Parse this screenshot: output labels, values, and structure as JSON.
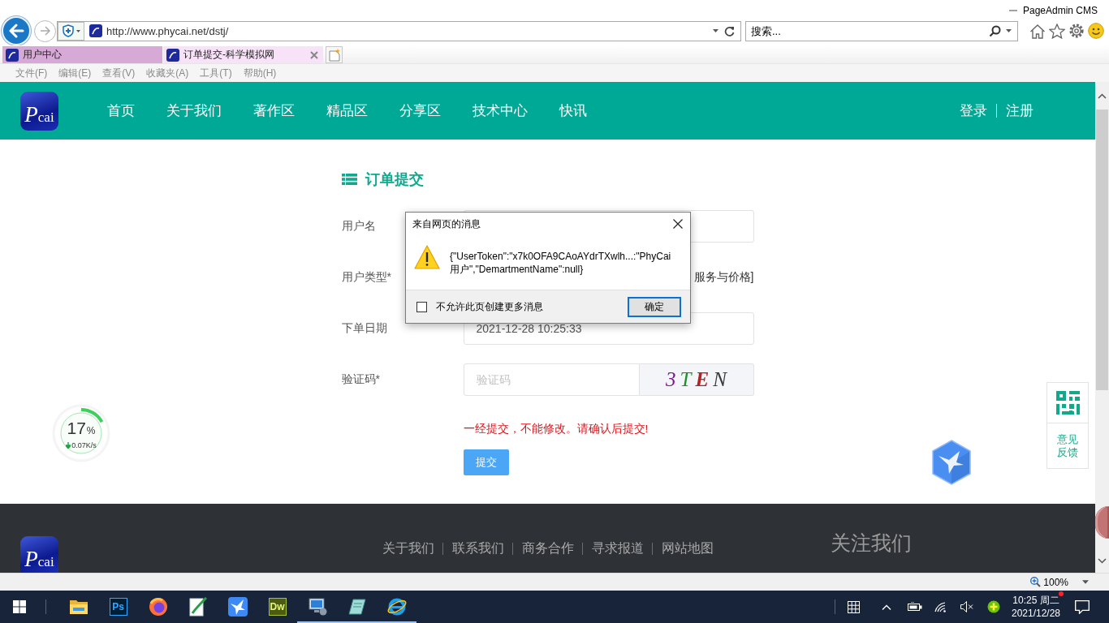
{
  "window": {
    "title": "PageAdmin CMS"
  },
  "browser": {
    "url": "http://www.phycai.net/dstj/",
    "search": {
      "placeholder": "搜索..."
    },
    "tabs": [
      {
        "label": "用户中心",
        "selected": false
      },
      {
        "label": "订单提交-科学模拟网",
        "selected": true
      }
    ],
    "menu": [
      "文件(F)",
      "编辑(E)",
      "查看(V)",
      "收藏夹(A)",
      "工具(T)",
      "帮助(H)"
    ]
  },
  "site": {
    "logo": "Pcai",
    "nav": [
      "首页",
      "关于我们",
      "著作区",
      "精品区",
      "分享区",
      "技术中心",
      "快讯"
    ],
    "auth": [
      "登录",
      "注册"
    ]
  },
  "form": {
    "title": "订单提交",
    "fields": [
      {
        "kind": "text",
        "label": "用户名"
      },
      {
        "kind": "choice",
        "label": "用户类型*",
        "text": "服务与价格]"
      },
      {
        "kind": "text",
        "label": "下单日期",
        "value": "2021-12-28 10:25:33"
      },
      {
        "kind": "captcha",
        "label": "验证码*",
        "placeholder": "验证码",
        "captcha": "3TEN"
      }
    ],
    "notice": "一经提交，不能修改。请确认后提交!",
    "submit": "提交"
  },
  "speed_meter": {
    "value": "17",
    "unit": "%",
    "speed": "0.07K/s",
    "level": 0.17
  },
  "side_panel": {
    "feedback": "意见反馈"
  },
  "dialog": {
    "title": "来自网页的消息",
    "message": "{\"UserToken\":\"x7k0OFA9CAoAYdrTXwlh...:\"PhyCai用户\",\"DemartmentName\":null}",
    "checkbox": {
      "label": "不允许此页创建更多消息",
      "checked": false
    },
    "button": "确定"
  },
  "footer": {
    "logo": "Pcai",
    "links": [
      "关于我们",
      "联系我们",
      "商务合作",
      "寻求报道",
      "网站地图"
    ],
    "follow_title": "关注我们"
  },
  "status_bar": {
    "zoom": "100%"
  },
  "taskbar": {
    "apps": [
      {
        "kind": "folder",
        "running": false
      },
      {
        "kind": "ps",
        "label": "Ps",
        "running": false
      },
      {
        "kind": "firefox",
        "running": false
      },
      {
        "kind": "pen",
        "running": false
      },
      {
        "kind": "bird",
        "running": false
      },
      {
        "kind": "dw",
        "label": "Dw",
        "running": false
      },
      {
        "kind": "computer",
        "running": true
      },
      {
        "kind": "notepad",
        "running": true
      },
      {
        "kind": "ie",
        "running": true
      }
    ],
    "clock": {
      "time": "10:25 周二",
      "date": "2021/12/28"
    }
  }
}
